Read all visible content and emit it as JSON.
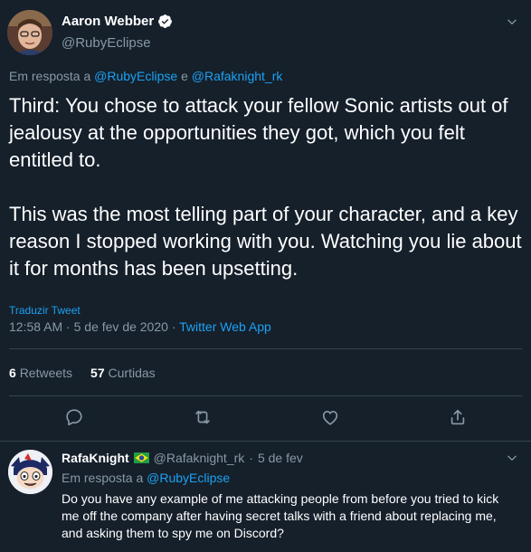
{
  "main_tweet": {
    "display_name": "Aaron Webber",
    "handle": "@RubyEclipse",
    "reply_prefix": "Em resposta a",
    "reply_user1": "@RubyEclipse",
    "reply_and": "e",
    "reply_user2": "@Rafaknight_rk",
    "text_p1": "Third: You chose to attack your fellow Sonic artists out of jealousy at the opportunities they got, which you felt entitled to.",
    "text_p2": "This was the most telling part of your character, and a key reason I stopped working with you. Watching you lie about it for months has been upsetting.",
    "translate_label": "Traduzir Tweet",
    "time": "12:58 AM",
    "date": "5 de fev de 2020",
    "separator": "·",
    "source": "Twitter Web App",
    "retweets_count": "6",
    "retweets_label": "Retweets",
    "likes_count": "57",
    "likes_label": "Curtidas"
  },
  "reply_tweet": {
    "display_name": "RafaKnight",
    "flag": "brazil-flag",
    "handle": "@Rafaknight_rk",
    "separator": "·",
    "date": "5 de fev",
    "reply_prefix": "Em resposta a",
    "reply_user": "@RubyEclipse",
    "text": "Do you have any example of me attacking people from before you tried to kick me off the company after having secret talks with a friend about replacing me, and asking them to spy me on Discord?"
  },
  "icons": [
    "verified-icon",
    "chevron-down-icon",
    "reply-icon",
    "retweet-icon",
    "like-icon",
    "share-icon",
    "brazil-flag-icon"
  ],
  "colors": {
    "background": "#15202b",
    "link": "#1da1f2",
    "secondary_text": "#8899a6",
    "divider": "#38444d"
  }
}
